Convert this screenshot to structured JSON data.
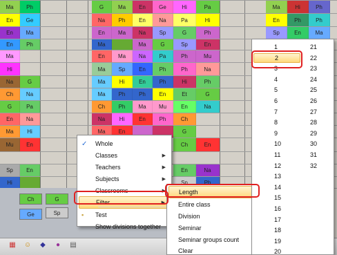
{
  "grid": {
    "rows": [
      [
        {
          "t": "Ma",
          "c": "#92d050"
        },
        {
          "t": "Ph",
          "c": "#00cc66"
        },
        null,
        null,
        {
          "t": "G",
          "c": "#66cc44"
        },
        {
          "t": "Ma",
          "c": "#92d050"
        },
        {
          "t": "En",
          "c": "#cc3366"
        },
        {
          "t": "Ge",
          "c": "#ff66cc"
        },
        {
          "t": "Hi",
          "c": "#ff66ff"
        },
        {
          "t": "Pa",
          "c": "#66cc44"
        },
        null,
        {
          "t": "Ma",
          "c": "#92d050"
        },
        {
          "t": "Hi",
          "c": "#cc3333"
        },
        {
          "t": "Ph",
          "c": "#6666cc"
        }
      ],
      [
        {
          "t": "En",
          "c": "#ffff00"
        },
        {
          "t": "Ge",
          "c": "#33ccff"
        },
        null,
        null,
        {
          "t": "Na",
          "c": "#ff6666"
        },
        {
          "t": "Ph",
          "c": "#ffcc00"
        },
        {
          "t": "En",
          "c": "#ffff66"
        },
        {
          "t": "Na",
          "c": "#ff9999"
        },
        {
          "t": "Pa",
          "c": "#ffff66"
        },
        {
          "t": "Hi",
          "c": "#ffff00"
        },
        null,
        {
          "t": "En",
          "c": "#ffff00"
        },
        {
          "t": "Ph",
          "c": "#339966"
        },
        {
          "t": "Ph",
          "c": "#33cccc"
        }
      ],
      [
        {
          "t": "En",
          "c": "#9933cc"
        },
        {
          "t": "Ma",
          "c": "#66aaff"
        },
        null,
        null,
        {
          "t": "En",
          "c": "#cc66cc"
        },
        {
          "t": "Ma",
          "c": "#cc66cc"
        },
        {
          "t": "Na",
          "c": "#cc3366"
        },
        {
          "t": "Sp",
          "c": "#9999ff"
        },
        {
          "t": "G",
          "c": "#66cc66"
        },
        {
          "t": "Ph",
          "c": "#cc66cc"
        },
        null,
        {
          "t": "Sp",
          "c": "#9999ff"
        },
        {
          "t": "En",
          "c": "#33cc66"
        },
        {
          "t": "Ma",
          "c": "#66aaff"
        }
      ],
      [
        {
          "t": "En",
          "c": "#3399ff"
        },
        {
          "t": "Ph",
          "c": "#66cc66"
        },
        null,
        null,
        {
          "t": "Ma",
          "c": "#3366cc"
        },
        {
          "t": "",
          "c": "#66aa33"
        },
        {
          "t": "Ma",
          "c": "#cc66cc"
        },
        {
          "t": "G",
          "c": "#66cc44"
        },
        {
          "t": "Sp",
          "c": "#9999ff"
        },
        {
          "t": "En",
          "c": "#cc3366"
        },
        null,
        {
          "t": "",
          "c": "#cccccc"
        },
        {
          "t": "",
          "c": "#cc3366"
        },
        {
          "t": "",
          "c": "#cc3366"
        }
      ],
      [
        {
          "t": "Ma",
          "c": "#ff99ff"
        },
        null,
        null,
        null,
        {
          "t": "En",
          "c": "#ff6666"
        },
        {
          "t": "Ma",
          "c": "#ff99cc"
        },
        {
          "t": "Na",
          "c": "#cc66ff"
        },
        {
          "t": "Pa",
          "c": "#33cccc"
        },
        {
          "t": "Ph",
          "c": "#cc66cc"
        },
        {
          "t": "Mu",
          "c": "#cc66cc"
        },
        null,
        null,
        null,
        null
      ],
      [
        {
          "t": "Hi",
          "c": "#ff33ff"
        },
        null,
        null,
        null,
        {
          "t": "Ma",
          "c": "#99cc99"
        },
        {
          "t": "Sp",
          "c": "#66aaff"
        },
        {
          "t": "En",
          "c": "#3366ff"
        },
        {
          "t": "Ph",
          "c": "#66cc66"
        },
        {
          "t": "Ph",
          "c": "#ff66cc"
        },
        {
          "t": "Na",
          "c": "#ff9999"
        },
        null,
        null,
        null,
        null
      ],
      [
        {
          "t": "Na",
          "c": "#996633"
        },
        {
          "t": "G",
          "c": "#66cc44"
        },
        null,
        null,
        {
          "t": "Ma",
          "c": "#66ccff"
        },
        {
          "t": "Hi",
          "c": "#ffff00"
        },
        {
          "t": "En",
          "c": "#33cc99"
        },
        {
          "t": "Ph",
          "c": "#3366cc"
        },
        {
          "t": "Hi",
          "c": "#cc3366"
        },
        {
          "t": "Ph",
          "c": "#66cc66"
        },
        null,
        null,
        null,
        null
      ],
      [
        {
          "t": "Ch",
          "c": "#ff9933"
        },
        {
          "t": "Na",
          "c": "#66ccff"
        },
        null,
        null,
        {
          "t": "Ma",
          "c": "#66ccff"
        },
        {
          "t": "Ph",
          "c": "#3366cc"
        },
        {
          "t": "Ph",
          "c": "#3366cc"
        },
        {
          "t": "En",
          "c": "#ffff00"
        },
        {
          "t": "Et",
          "c": "#66cc66"
        },
        {
          "t": "G",
          "c": "#66cc44"
        },
        null,
        null,
        null,
        null
      ],
      [
        {
          "t": "G",
          "c": "#66cc44"
        },
        {
          "t": "Pa",
          "c": "#66cc66"
        },
        null,
        null,
        {
          "t": "Ch",
          "c": "#ff9933"
        },
        {
          "t": "Ph",
          "c": "#33cc66"
        },
        {
          "t": "Ma",
          "c": "#ff99cc"
        },
        {
          "t": "Mu",
          "c": "#ff99cc"
        },
        {
          "t": "En",
          "c": "#66ff66"
        },
        {
          "t": "Na",
          "c": "#33cccc"
        },
        null,
        null,
        null,
        null
      ],
      [
        {
          "t": "En",
          "c": "#ff6666"
        },
        {
          "t": "Na",
          "c": "#ff9999"
        },
        null,
        null,
        {
          "t": "Na",
          "c": "#cc3366"
        },
        {
          "t": "Hi",
          "c": "#ff66ff"
        },
        {
          "t": "En",
          "c": "#ff3333"
        },
        {
          "t": "Ph",
          "c": "#ff66cc"
        },
        {
          "t": "Ch",
          "c": "#ff9933"
        },
        null,
        null,
        null,
        null,
        null
      ],
      [
        {
          "t": "Ma",
          "c": "#ff9933"
        },
        {
          "t": "Hi",
          "c": "#66ccff"
        },
        null,
        null,
        {
          "t": "Ma",
          "c": "#ff6666"
        },
        {
          "t": "En",
          "c": "#ff3333"
        },
        {
          "t": "",
          "c": "#cc66cc"
        },
        {
          "t": "",
          "c": "#cc3366"
        },
        {
          "t": "G",
          "c": "#66cc44"
        },
        null,
        null,
        null,
        null,
        null
      ],
      [
        {
          "t": "Mu",
          "c": "#996633"
        },
        {
          "t": "En",
          "c": "#ff3333"
        },
        null,
        null,
        null,
        null,
        null,
        null,
        {
          "t": "Ch",
          "c": "#66cc44"
        },
        {
          "t": "En",
          "c": "#ff3333"
        },
        null,
        null,
        null,
        null
      ],
      [
        null,
        null,
        null,
        null,
        null,
        null,
        null,
        null,
        null,
        null,
        null,
        null,
        null,
        null
      ],
      [
        {
          "t": "Sp",
          "c": "#aaaaaa"
        },
        {
          "t": "En",
          "c": "#66cc66"
        },
        null,
        null,
        null,
        null,
        null,
        null,
        {
          "t": "En",
          "c": "#66cc66"
        },
        {
          "t": "Na",
          "c": "#9933cc"
        },
        null,
        null,
        null,
        null
      ],
      [
        {
          "t": "Hi",
          "c": "#3366cc"
        },
        {
          "t": "",
          "c": "#66aa33"
        },
        null,
        null,
        null,
        null,
        null,
        null,
        {
          "t": "Sp",
          "c": "#cccccc"
        },
        {
          "t": "Ph",
          "c": "#3366cc"
        },
        null,
        null,
        null,
        null
      ]
    ],
    "bottom_cells": [
      {
        "t": "Ch",
        "c": "#66cc44"
      },
      {
        "t": "G",
        "c": "#66cc44"
      },
      {
        "t": "Ge",
        "c": "#66aaff"
      },
      {
        "t": "Sp",
        "c": "#cccccc"
      }
    ]
  },
  "context_menu": {
    "items": [
      {
        "label": "Whole",
        "checked": true,
        "submenu": false
      },
      {
        "label": "Classes",
        "checked": false,
        "submenu": true
      },
      {
        "label": "Teachers",
        "checked": false,
        "submenu": true
      },
      {
        "label": "Subjects",
        "checked": false,
        "submenu": true
      },
      {
        "label": "Classrooms",
        "checked": false,
        "submenu": true
      },
      {
        "label": "Filter",
        "checked": false,
        "submenu": true
      },
      {
        "label": "Test",
        "checked": false,
        "submenu": false
      },
      {
        "label": "Show divisions together",
        "checked": false,
        "submenu": false
      }
    ]
  },
  "filter_menu": {
    "items": [
      {
        "label": "Length",
        "submenu": true
      },
      {
        "label": "Entire class",
        "submenu": false
      },
      {
        "label": "Division",
        "submenu": false
      },
      {
        "label": "Seminar",
        "submenu": false
      },
      {
        "label": "Seminar groups count",
        "submenu": true
      },
      {
        "label": "Clear",
        "submenu": false
      }
    ]
  },
  "length_menu": {
    "col1": [
      "1",
      "2",
      "3",
      "4",
      "5",
      "6",
      "7",
      "8",
      "9",
      "10",
      "11",
      "12",
      "13",
      "14",
      "15",
      "16",
      "17",
      "18",
      "19",
      "20"
    ],
    "col2": [
      "21",
      "22",
      "23",
      "24",
      "25",
      "26",
      "27",
      "28",
      "29",
      "30",
      "31",
      "32"
    ],
    "selected": "2"
  },
  "toolbar": {
    "icons": [
      "grid-icon",
      "person-icon",
      "hat-icon",
      "globe-icon",
      "chart-icon"
    ]
  }
}
